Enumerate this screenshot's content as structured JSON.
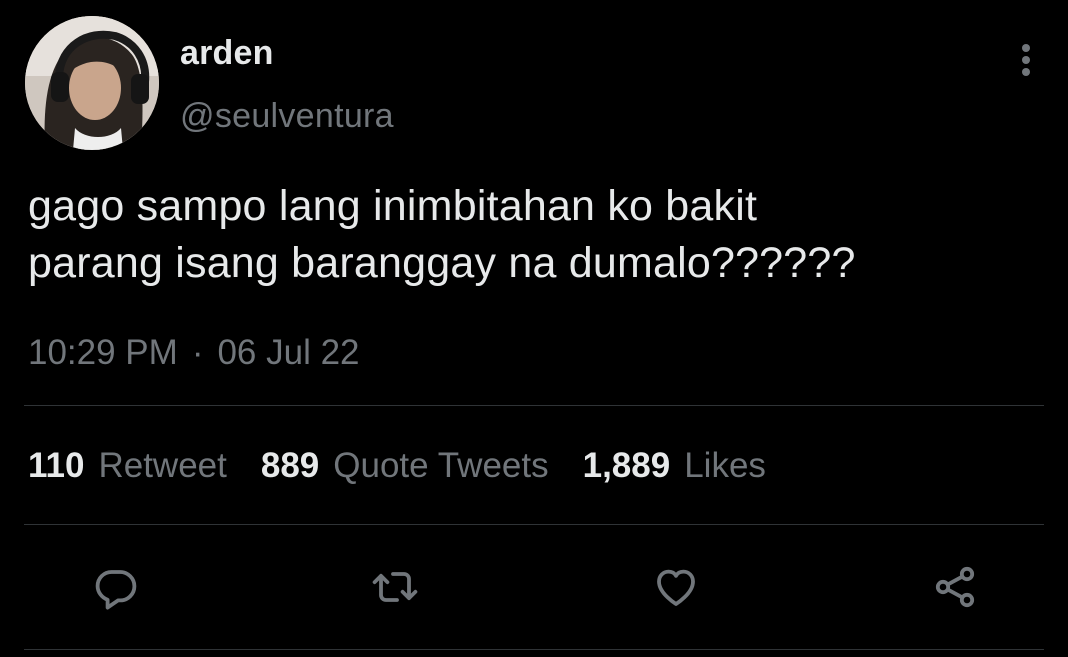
{
  "user": {
    "display_name": "arden",
    "handle": "@seulventura"
  },
  "tweet": {
    "text_lines": [
      "gago sampo lang inimbitahan ko bakit",
      "parang isang baranggay na dumalo??????"
    ],
    "time": "10:29 PM",
    "separator": "·",
    "date": "06 Jul 22"
  },
  "stats": {
    "retweets_count": "110",
    "retweets_label": "Retweet",
    "quotes_count": "889",
    "quotes_label": "Quote Tweets",
    "likes_count": "1,889",
    "likes_label": "Likes"
  },
  "icons": {
    "more": "more-vertical-icon",
    "reply": "reply-icon",
    "retweet": "retweet-icon",
    "like": "heart-icon",
    "share": "share-icon"
  },
  "colors": {
    "background": "#000000",
    "primary_text": "#e7e9ea",
    "secondary_text": "#71767b",
    "divider": "#2f3336"
  }
}
